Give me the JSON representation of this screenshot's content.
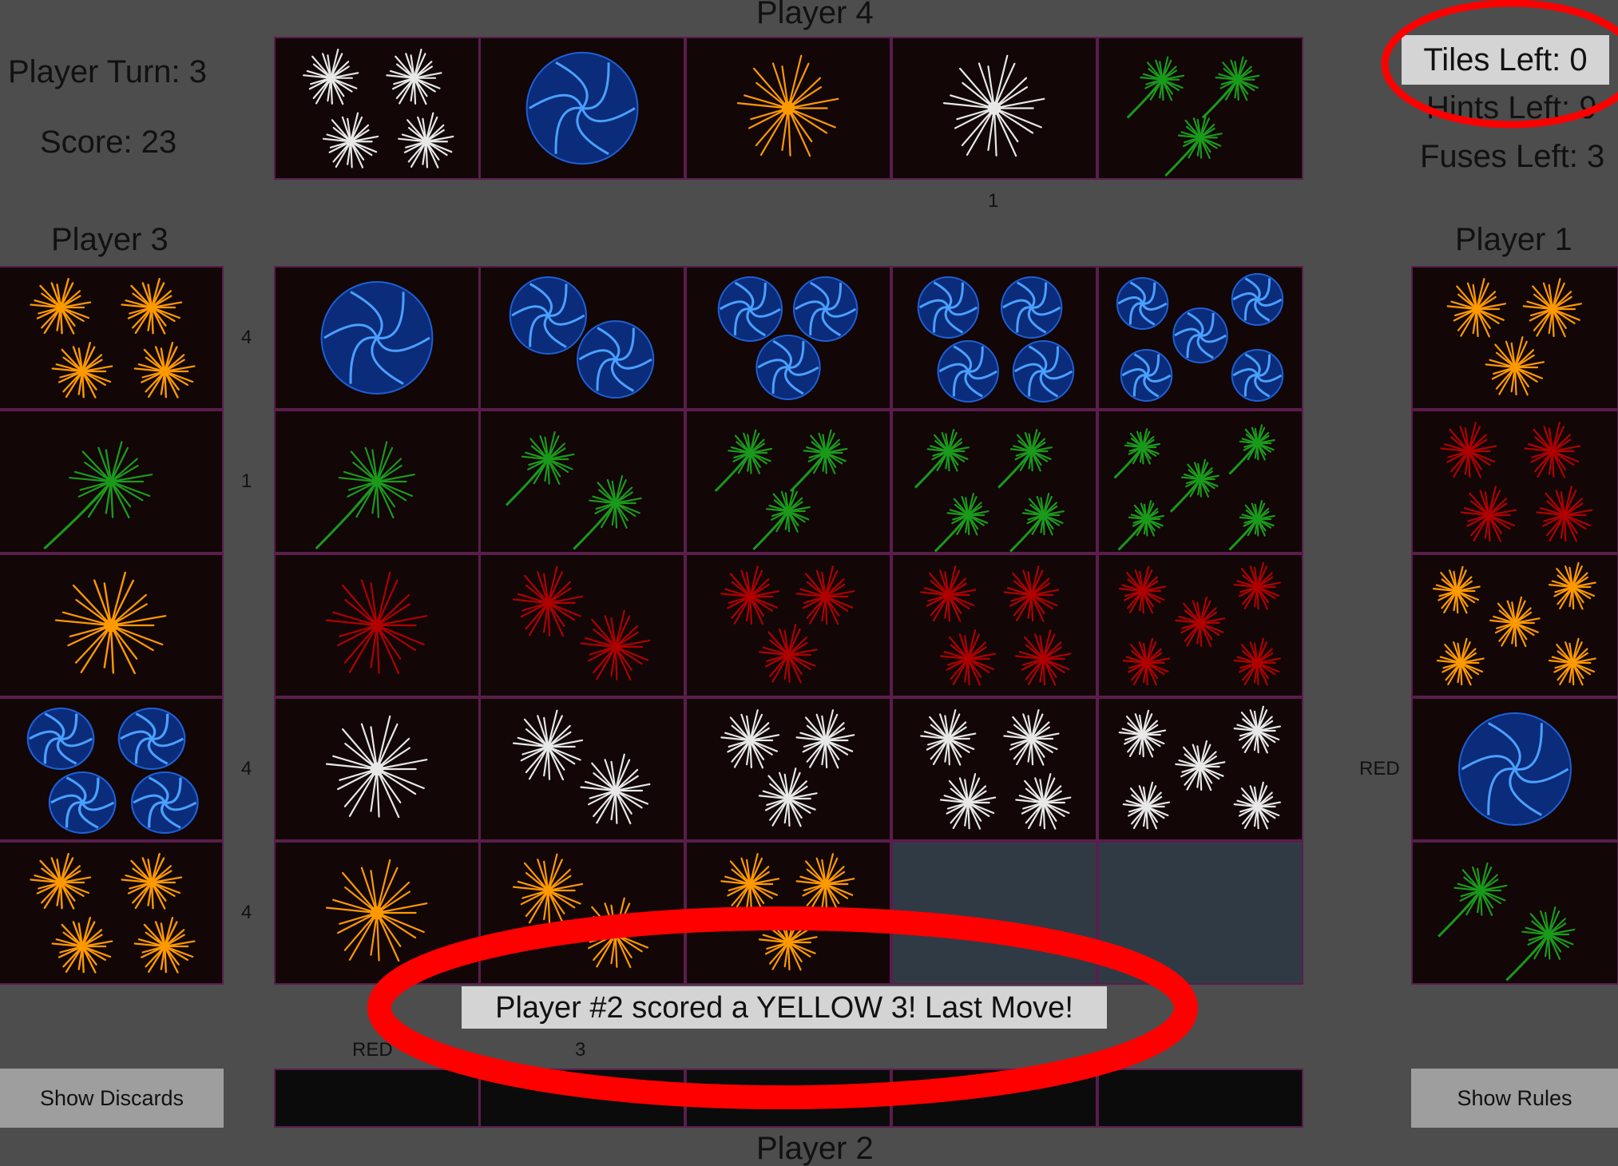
{
  "status": {
    "player_turn_label": "Player Turn: 3",
    "score_label": "Score: 23",
    "tiles_left_label": "Tiles Left: 0",
    "hints_left_label": "Hints Left: 9",
    "fuses_left_label": "Fuses Left: 3"
  },
  "players": {
    "p4": {
      "name": "Player 4",
      "hand": [
        {
          "color": "white",
          "count": 4
        },
        {
          "color": "blue",
          "count": 1
        },
        {
          "color": "yellow",
          "count": 1
        },
        {
          "color": "white",
          "count": 1
        },
        {
          "color": "green",
          "count": 3
        }
      ],
      "hints": [
        "",
        "",
        "",
        "1",
        ""
      ]
    },
    "p3": {
      "name": "Player 3",
      "hand": [
        {
          "color": "yellow",
          "count": 4
        },
        {
          "color": "green",
          "count": 1
        },
        {
          "color": "yellow",
          "count": 1
        },
        {
          "color": "blue",
          "count": 4
        },
        {
          "color": "yellow",
          "count": 4
        }
      ],
      "hints": [
        "4",
        "1",
        "",
        "4",
        "4"
      ]
    },
    "p1": {
      "name": "Player 1",
      "hand": [
        {
          "color": "yellow",
          "count": 3
        },
        {
          "color": "red",
          "count": 4
        },
        {
          "color": "yellow",
          "count": 5
        },
        {
          "color": "blue",
          "count": 1
        },
        {
          "color": "green",
          "count": 2
        }
      ],
      "hints": [
        "",
        "",
        "",
        "RED",
        ""
      ]
    },
    "p2": {
      "name": "Player 2",
      "hints": [
        "RED",
        "3",
        "",
        "",
        ""
      ]
    }
  },
  "board": {
    "rows": [
      {
        "color": "blue",
        "played": 5
      },
      {
        "color": "green",
        "played": 5
      },
      {
        "color": "red",
        "played": 5
      },
      {
        "color": "white",
        "played": 5
      },
      {
        "color": "yellow",
        "played": 3
      }
    ]
  },
  "message": "Player #2 scored a YELLOW 3! Last Move!",
  "buttons": {
    "discards": "Show Discards",
    "rules": "Show Rules"
  },
  "colors": {
    "background": "#4d4d4d",
    "tile_bg": "#120607",
    "tile_border": "#5a1d4d",
    "empty_slot": "#303a45",
    "annotation": "#ff0000",
    "firework_blue": "#1e5fd6",
    "firework_green": "#1a9a1a",
    "firework_red": "#b00000",
    "firework_white": "#e8e8e8",
    "firework_yellow": "#ff9900"
  }
}
